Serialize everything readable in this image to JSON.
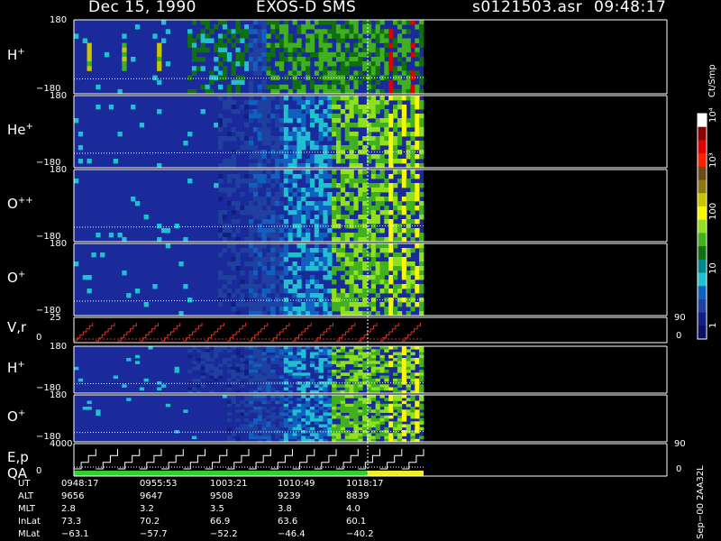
{
  "header": {
    "date": "Dec 15, 1990",
    "instrument": "EXOS-D SMS",
    "file": "s0121503.asr",
    "time": "09:48:17"
  },
  "chart_data": {
    "type": "heatmap",
    "panels": [
      {
        "id": "h-plus",
        "label": "H",
        "sup": "+",
        "ymax": "180",
        "ymin": "−180",
        "kind": "spectrogram",
        "end_col": 0.7,
        "onset_col": 0.22
      },
      {
        "id": "he-plus",
        "label": "He",
        "sup": "+",
        "ymax": "180",
        "ymin": "−180",
        "kind": "spectrogram",
        "end_col": 0.7,
        "onset_col": 0.28
      },
      {
        "id": "o-plus-plus",
        "label": "O",
        "sup": "++",
        "ymax": "180",
        "ymin": "−180",
        "kind": "spectrogram",
        "end_col": 0.7,
        "onset_col": 0.28
      },
      {
        "id": "o-plus",
        "label": "O",
        "sup": "+",
        "ymax": "180",
        "ymin": "−180",
        "kind": "spectrogram",
        "end_col": 0.7,
        "onset_col": 0.28
      },
      {
        "id": "v-r",
        "label": "V,r",
        "sup": "",
        "ymax": "25",
        "ymin": "0",
        "right_max": "90",
        "right_min": "0",
        "kind": "sweep"
      },
      {
        "id": "h-plus-2",
        "label": "H",
        "sup": "+",
        "ymax": "180",
        "ymin": "−180",
        "kind": "spectrogram",
        "end_col": 0.7,
        "onset_col": 0.22
      },
      {
        "id": "o-plus-2",
        "label": "O",
        "sup": "+",
        "ymax": "180",
        "ymin": "−180",
        "kind": "spectrogram",
        "end_col": 0.7,
        "onset_col": 0.3
      },
      {
        "id": "e-p",
        "label": "E,p",
        "sub_label": "QA",
        "sup": "",
        "ymax": "4000",
        "ymin": "0",
        "right_max": "90",
        "right_min": "0",
        "kind": "steps"
      }
    ],
    "colorbar": {
      "title": "Ct/Smp",
      "tick_labels": [
        "10⁴",
        "10³",
        "100",
        "10",
        "1"
      ],
      "colors": [
        "#ffffff",
        "#8b0000",
        "#e00000",
        "#ff2000",
        "#6b4a1a",
        "#8a7a10",
        "#c8c400",
        "#f8f800",
        "#90e020",
        "#40b020",
        "#107010",
        "#008888",
        "#20c0d0",
        "#1060c0",
        "#2040a0",
        "#102080",
        "#0a1060"
      ]
    },
    "time_axis": {
      "row_labels": [
        "UT",
        "ALT",
        "MLT",
        "InLat",
        "MLat"
      ],
      "columns": [
        {
          "UT": "0948:17",
          "ALT": "9656",
          "MLT": "2.8",
          "InLat": "73.3",
          "MLat": "−63.1"
        },
        {
          "UT": "0955:53",
          "ALT": "9647",
          "MLT": "3.2",
          "InLat": "70.2",
          "MLat": "−57.7"
        },
        {
          "UT": "1003:21",
          "ALT": "9508",
          "MLT": "3.5",
          "InLat": "66.9",
          "MLat": "−52.2"
        },
        {
          "UT": "1010:49",
          "ALT": "9239",
          "MLT": "3.8",
          "InLat": "63.6",
          "MLat": "−46.4"
        },
        {
          "UT": "1018:17",
          "ALT": "8839",
          "MLT": "4.0",
          "InLat": "60.1",
          "MLat": "−40.2"
        }
      ]
    },
    "qa_bar": [
      {
        "color": "#30d030",
        "fraction": 0.84
      },
      {
        "color": "#f0f020",
        "fraction": 0.16
      }
    ],
    "side_note": "Sep−00  2AA32L"
  }
}
